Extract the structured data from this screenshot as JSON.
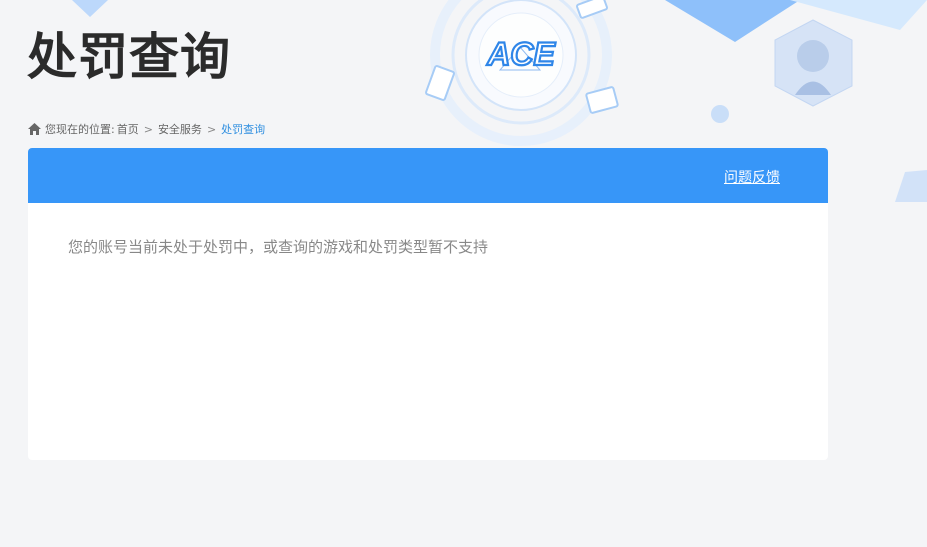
{
  "page": {
    "title": "处罚查询"
  },
  "breadcrumb": {
    "prefix": "您现在的位置:",
    "items": [
      "首页",
      "安全服务",
      "处罚查询"
    ],
    "separator": ">"
  },
  "panel": {
    "header_link": "问题反馈",
    "message": "您的账号当前未处于处罚中，或查询的游戏和处罚类型暂不支持"
  },
  "brand": {
    "logo_icon": "ace-logo-icon",
    "accent_color": "#3796f8"
  }
}
